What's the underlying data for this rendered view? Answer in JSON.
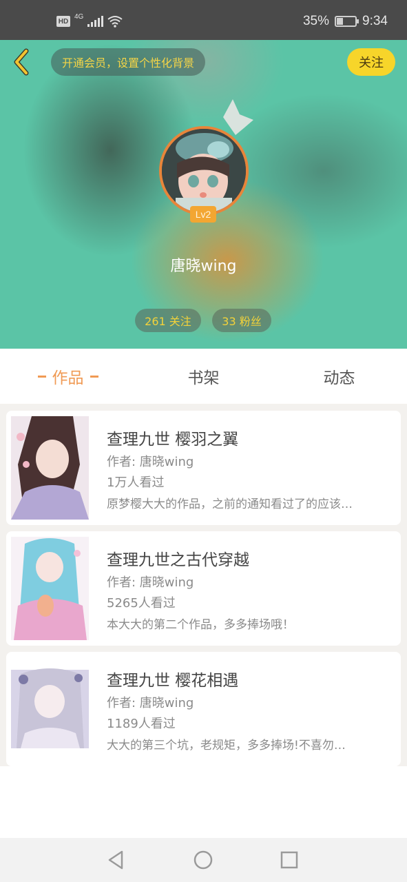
{
  "status_bar": {
    "network": "4G",
    "hd": "HD",
    "battery_percent": "35%",
    "battery_level": 0.35,
    "time": "9:34"
  },
  "header": {
    "vip_prompt": "开通会员，设置个性化背景",
    "follow_label": "关注",
    "level": "Lv2",
    "username": "唐晓wing",
    "following": "261 关注",
    "followers": "33 粉丝",
    "accent_color": "#f7d52a",
    "bg_color": "#5bc4a6"
  },
  "tabs": [
    {
      "label": "作品",
      "active": true
    },
    {
      "label": "书架",
      "active": false
    },
    {
      "label": "动态",
      "active": false
    }
  ],
  "works": [
    {
      "title": "查理九世 樱羽之翼",
      "author": "作者: 唐晓wing",
      "views": "1万人看过",
      "desc": "原梦樱大大的作品，之前的通知看过了的应该…"
    },
    {
      "title": "查理九世之古代穿越",
      "author": "作者: 唐晓wing",
      "views": "5265人看过",
      "desc": "本大大的第二个作品，多多捧场哦！"
    },
    {
      "title": "查理九世 樱花相遇",
      "author": "作者: 唐晓wing",
      "views": "1189人看过",
      "desc": "大大的第三个坑，老规矩，多多捧场!不喜勿…"
    }
  ],
  "icons": {
    "back": "chevron-left-icon",
    "crown": "crown-icon",
    "nav_back": "triangle-back-icon",
    "nav_home": "circle-home-icon",
    "nav_recent": "square-recent-icon"
  }
}
